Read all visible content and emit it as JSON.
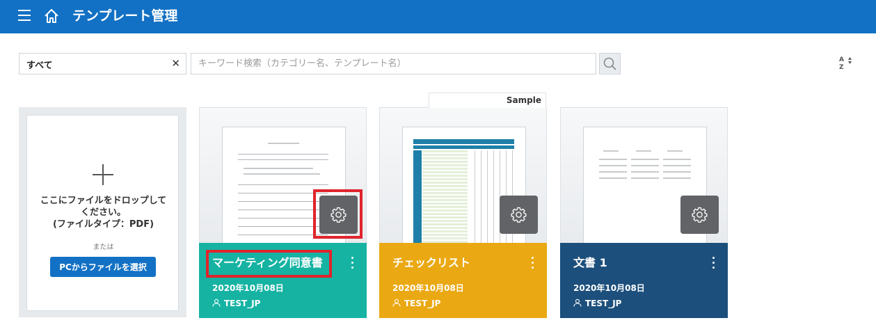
{
  "header": {
    "title": "テンプレート管理",
    "bg_color": "#1271c4",
    "menu_icon": "hamburger-icon",
    "home_icon": "home-icon"
  },
  "toolbar": {
    "filter_value": "すべて",
    "clear_icon": "close-icon",
    "search_placeholder": "キーワード検索（カテゴリー名、テンプレート名）",
    "search_icon": "search-icon",
    "sort_icon": "sort-alpha-icon"
  },
  "dropzone": {
    "text": "ここにファイルをドロップして\nください。\n(ファイルタイプ：PDF)",
    "or_text": "または",
    "button_label": "PCからファイルを選択",
    "icon": "plus-icon"
  },
  "templates": [
    {
      "title": "マーケティング同意書",
      "date": "2020年10月08日",
      "user": "TEST_JP",
      "color": "#16b3a3",
      "sample": ""
    },
    {
      "title": "チェックリスト",
      "date": "2020年10月08日",
      "user": "TEST_JP",
      "color": "#eaa813",
      "sample": "Sample"
    },
    {
      "title": "文書 1",
      "date": "2020年10月08日",
      "user": "TEST_JP",
      "color": "#1c4f7c",
      "sample": ""
    }
  ]
}
